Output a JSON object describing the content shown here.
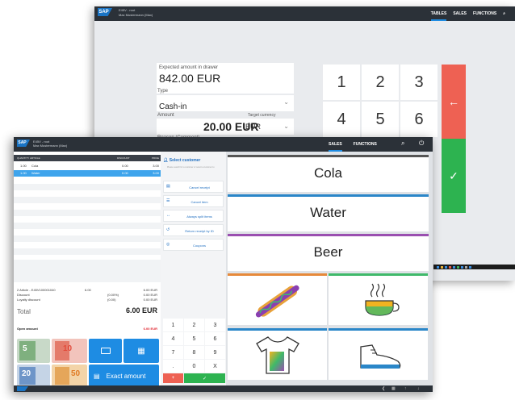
{
  "back": {
    "topbar": {
      "logo": "SAP",
      "line1": "E45V - root",
      "line2": "Max Mustermann (Max)"
    },
    "nav": [
      "TABLES",
      "SALES",
      "FUNCTIONS"
    ],
    "expected_label": "Expected amount in drawer",
    "expected_value": "842.00 EUR",
    "type_label": "Type",
    "type_value": "Cash-in",
    "amount_label": "Amount",
    "target_currency_label": "Target currency",
    "amount_value": "20.00 EUR",
    "currency_value": "EUR",
    "reason_label": "Reason (Comment)",
    "keys": [
      "1",
      "2",
      "3",
      "4",
      "5",
      "6"
    ],
    "backspace": "←",
    "confirm": "✓"
  },
  "front": {
    "topbar": {
      "logo": "SAP",
      "line1": "E45V - root",
      "line2": "Max Mustermann (Max)"
    },
    "nav": [
      "SALES",
      "FUNCTIONS"
    ],
    "columns": {
      "quantity": "QUANTITY",
      "article": "ARTICLE",
      "discount": "DISCOUNT",
      "price": "PRICE"
    },
    "rows": [
      {
        "qty": "1.00",
        "article": "Cola",
        "discount": "0.00",
        "price": "3.00"
      },
      {
        "qty": "1.00",
        "article": "Water",
        "discount": "0.00",
        "price": "3.00"
      }
    ],
    "summary": {
      "article_line": "2 Article - E45V100001040",
      "article_amount": "6.00",
      "article_total": "6.00 EUR",
      "discount_label": "Discount",
      "discount_pct": "(0.00%)",
      "discount_value": "0.00 EUR",
      "loyalty_label": "Loyalty discount",
      "loyalty_amount": "(0.00)",
      "loyalty_value": "0.00 EUR",
      "total_label": "Total",
      "total_value": "6.00 EUR",
      "open_label": "Open amount",
      "open_value": "6.00 EUR"
    },
    "notes": [
      "5",
      "10",
      "20",
      "50"
    ],
    "exact_amount": "Exact amount",
    "select_customer": "Select customer",
    "select_customer_hint": "Please search for a customer or select a customer to",
    "actions": [
      "Cancel receipt",
      "Cancel item",
      "Always split items",
      "Return receipt by ID",
      "Coupons"
    ],
    "keys": [
      "1",
      "2",
      "3",
      "4",
      "5",
      "6",
      "7",
      "8",
      "9",
      ".",
      "0",
      "X"
    ],
    "minus": "+",
    "ok": "✓",
    "products": [
      "Cola",
      "Water",
      "Beer"
    ],
    "accent_colors": {
      "blue": "#1e8ce3",
      "red": "#ee6153",
      "green": "#2db350"
    }
  }
}
